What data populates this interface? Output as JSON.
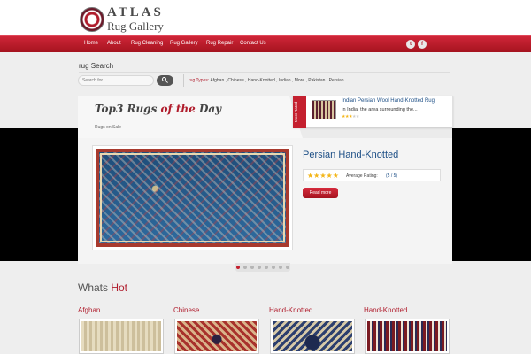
{
  "brand": {
    "logo_line1": "ATLAS",
    "logo_line2": "Rug Gallery"
  },
  "nav": {
    "items": [
      "Home",
      "About",
      "Rug Cleaning",
      "Rug Gallery",
      "Rug Repair",
      "Contact Us"
    ],
    "social": [
      {
        "icon": "twitter-icon",
        "glyph": "t"
      },
      {
        "icon": "facebook-icon",
        "glyph": "f"
      }
    ]
  },
  "search": {
    "title": "rug Search",
    "placeholder": "Search for",
    "types_label": "rug Types:",
    "types": "Afghan , Chinese , Hand-Knotted , Indian , More , Pakistan , Persian"
  },
  "featured": {
    "title_part1": "Top3 Rugs ",
    "title_part2": "of the ",
    "title_part3": "Day",
    "subtitle": "Rugs on Sale",
    "product_title": "Persian Hand-Knotted",
    "stars": "★★★★★",
    "avg_label": "Average Rating:",
    "score": "(5 / 5)",
    "read_more": "Read more",
    "slides": 8,
    "active_slide": 1
  },
  "most_rated": {
    "tab_label": "Most Rated",
    "title": "Indian Persian Wool Hand-Knotted Rug",
    "desc": "In India, the area surrounding the...",
    "stars_on": "★★★",
    "stars_off": "★★"
  },
  "whats_hot": {
    "title_part1": "Whats ",
    "title_part2": "Hot",
    "items": [
      "Afghan",
      "Chinese",
      "Hand-Knotted",
      "Hand-Knotted"
    ]
  },
  "colors": {
    "accent": "#b01c2c",
    "link": "#1d4f86",
    "star": "#f3b517"
  }
}
